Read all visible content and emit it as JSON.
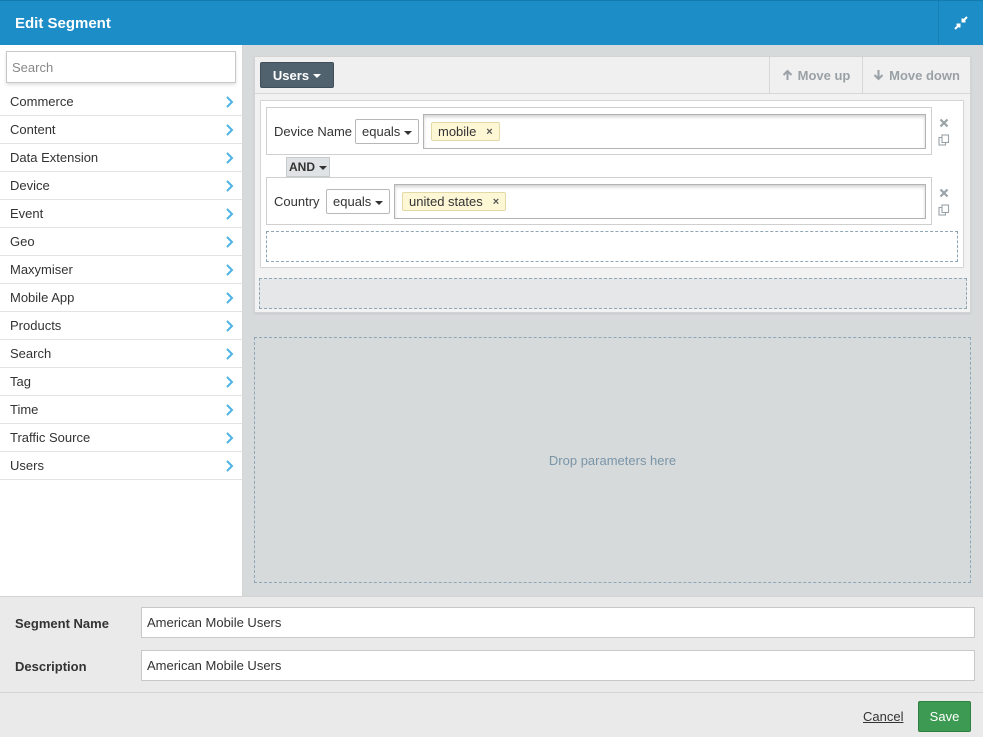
{
  "dialog": {
    "title": "Edit Segment"
  },
  "sidebar": {
    "search_placeholder": "Search",
    "items": [
      {
        "label": "Commerce"
      },
      {
        "label": "Content"
      },
      {
        "label": "Data Extension"
      },
      {
        "label": "Device"
      },
      {
        "label": "Event"
      },
      {
        "label": "Geo"
      },
      {
        "label": "Maxymiser"
      },
      {
        "label": "Mobile App"
      },
      {
        "label": "Products"
      },
      {
        "label": "Search"
      },
      {
        "label": "Tag"
      },
      {
        "label": "Time"
      },
      {
        "label": "Traffic Source"
      },
      {
        "label": "Users"
      }
    ]
  },
  "rule": {
    "scope_label": "Users",
    "move_up_label": "Move up",
    "move_down_label": "Move down",
    "conditions": [
      {
        "name": "Device Name",
        "operator": "equals",
        "value": "mobile"
      },
      {
        "name": "Country",
        "operator": "equals",
        "value": "united states"
      }
    ],
    "connector": "AND"
  },
  "drop_zone": {
    "label": "Drop parameters here"
  },
  "form": {
    "segment_name_label": "Segment Name",
    "segment_name_value": "American Mobile Users",
    "description_label": "Description",
    "description_value": "American Mobile Users"
  },
  "footer": {
    "cancel_label": "Cancel",
    "save_label": "Save"
  },
  "colors": {
    "titlebar": "#1c8dc6",
    "scope_button": "#51626f",
    "save_button": "#3d9a52",
    "tag_background": "#fdf7d6"
  }
}
